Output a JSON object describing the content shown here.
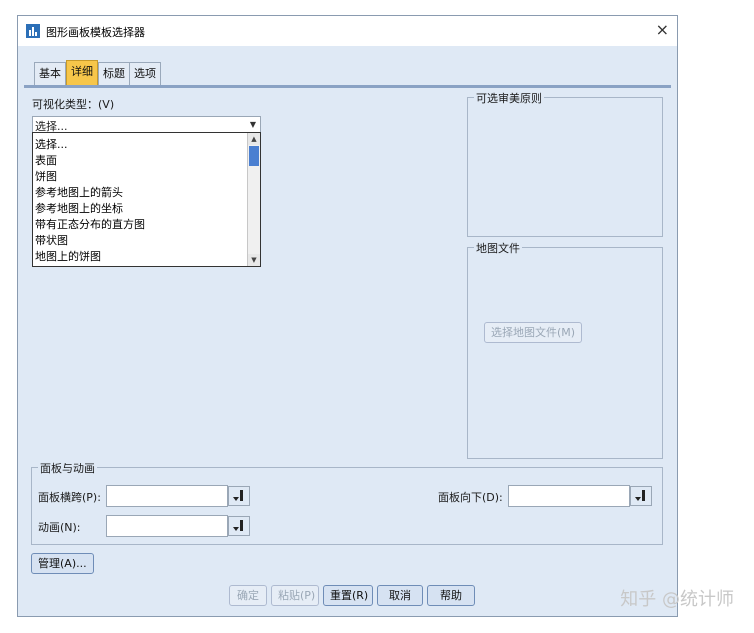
{
  "window": {
    "title": "图形画板模板选择器",
    "close_glyph": "×"
  },
  "tabs": [
    {
      "label": "基本"
    },
    {
      "label": "详细"
    },
    {
      "label": "标题"
    },
    {
      "label": "选项"
    }
  ],
  "visual_type": {
    "label": "可视化类型：(V)",
    "selected": "选择...",
    "options": [
      "选择...",
      "表面",
      "饼图",
      "参考地图上的箭头",
      "参考地图上的坐标",
      "带有正态分布的直方图",
      "带状图",
      "地图上的饼图"
    ]
  },
  "aesthetics_group": {
    "legend": "可选审美原则"
  },
  "map_file_group": {
    "legend": "地图文件",
    "select_button": "选择地图文件(M)"
  },
  "panels_group": {
    "legend": "面板与动画",
    "panel_across_label": "面板横跨(P):",
    "panel_down_label": "面板向下(D):",
    "animation_label": "动画(N):"
  },
  "manage_button": "管理(A)...",
  "footer": {
    "ok": "确定",
    "paste": "粘贴(P)",
    "reset": "重置(R)",
    "cancel": "取消",
    "help": "帮助"
  },
  "watermark": "知乎 @统计师",
  "colors": {
    "active_tab": "#f7c64a",
    "dialog_bg": "#dfe9f5",
    "accent": "#4a7fd1"
  }
}
